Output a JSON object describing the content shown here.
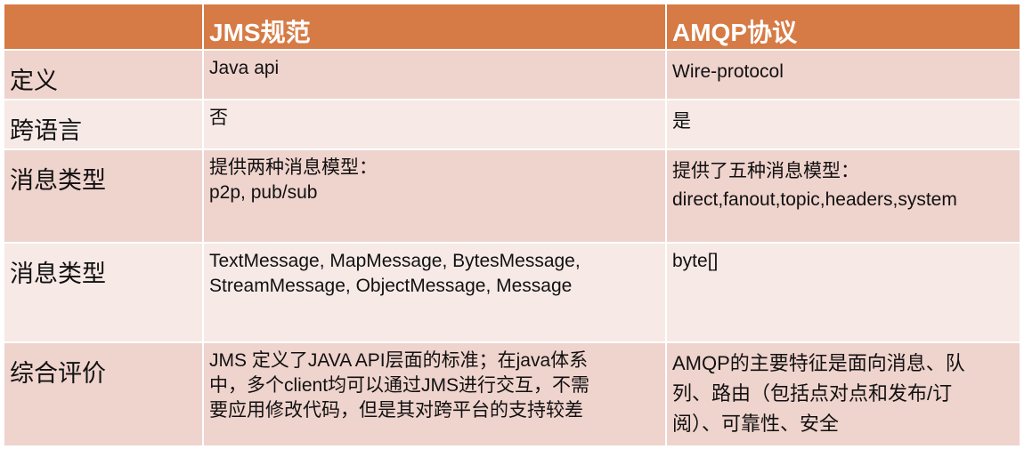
{
  "header": {
    "col0": "",
    "col1": "JMS规范",
    "col2": "AMQP协议"
  },
  "rows": [
    {
      "label": "定义",
      "jms": [
        "Java api"
      ],
      "amqp": [
        "Wire-protocol"
      ]
    },
    {
      "label": "跨语言",
      "jms": [
        "否"
      ],
      "amqp": [
        "是"
      ]
    },
    {
      "label": "消息类型",
      "jms": [
        "提供两种消息模型：",
        "p2p, pub/sub"
      ],
      "amqp": [
        "提供了五种消息模型：",
        "direct,fanout,topic,headers,system"
      ]
    },
    {
      "label": "消息类型",
      "jms": [
        "TextMessage, MapMessage, BytesMessage,",
        "StreamMessage, ObjectMessage, Message"
      ],
      "amqp": [
        "byte[]"
      ]
    },
    {
      "label": "综合评价",
      "jms": [
        "JMS 定义了JAVA API层面的标准；在java体系",
        "中，多个client均可以通过JMS进行交互，不需",
        "要应用修改代码，但是其对跨平台的支持较差"
      ],
      "amqp": [
        "AMQP的主要特征是面向消息、队",
        "列、路由（包括点对点和发布/订",
        "阅）、可靠性、安全"
      ]
    }
  ],
  "colors": {
    "header": "#D67B45",
    "row_dark": "#EFD3CD",
    "row_light": "#F7E9E6"
  }
}
